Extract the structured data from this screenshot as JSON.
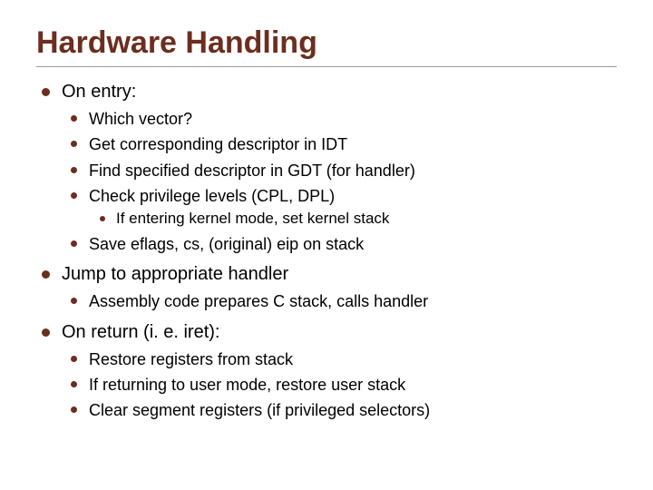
{
  "title": "Hardware Handling",
  "items": [
    {
      "text": "On entry:",
      "children": [
        {
          "text": "Which vector?"
        },
        {
          "text": "Get corresponding descriptor in IDT"
        },
        {
          "text": "Find specified descriptor in GDT (for handler)"
        },
        {
          "text": "Check privilege levels (CPL, DPL)",
          "children": [
            {
              "text": "If entering kernel mode, set kernel stack"
            }
          ]
        },
        {
          "text": "Save eflags, cs, (original) eip on stack"
        }
      ]
    },
    {
      "text": "Jump to appropriate handler",
      "children": [
        {
          "text": "Assembly code prepares C stack, calls handler"
        }
      ]
    },
    {
      "text": "On return (i. e. iret):",
      "children": [
        {
          "text": "Restore registers from stack"
        },
        {
          "text": "If returning to user mode, restore user stack"
        },
        {
          "text": "Clear segment registers (if privileged selectors)"
        }
      ]
    }
  ]
}
